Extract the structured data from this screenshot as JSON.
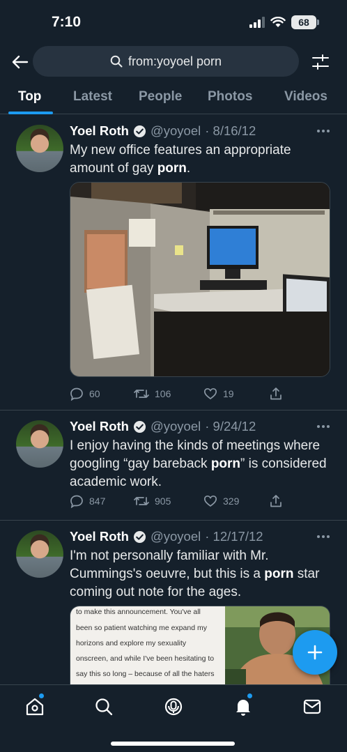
{
  "status_bar": {
    "time": "7:10",
    "battery": "68"
  },
  "search": {
    "query": "from:yoyoel porn"
  },
  "tabs": [
    {
      "label": "Top",
      "active": true
    },
    {
      "label": "Latest",
      "active": false
    },
    {
      "label": "People",
      "active": false
    },
    {
      "label": "Photos",
      "active": false
    },
    {
      "label": "Videos",
      "active": false
    }
  ],
  "tweets": [
    {
      "name": "Yoel Roth",
      "handle": "@yoyoel",
      "date": "· 8/16/12",
      "text_before": "My new office features an appropriate amount of gay ",
      "text_bold": "porn",
      "text_after": ".",
      "replies": "60",
      "retweets": "106",
      "likes": "19"
    },
    {
      "name": "Yoel Roth",
      "handle": "@yoyoel",
      "date": "· 9/24/12",
      "text_before": "I enjoy having the kinds of meetings where googling “gay bareback ",
      "text_bold": "porn",
      "text_after": "” is considered academic work.",
      "replies": "847",
      "retweets": "905",
      "likes": "329"
    },
    {
      "name": "Yoel Roth",
      "handle": "@yoyoel",
      "date": "· 12/17/12",
      "text_before": "I'm not personally familiar with Mr. Cummings's oeuvre, but this is a ",
      "text_bold": "porn",
      "text_after": " star coming out note for the ages.",
      "media_text": [
        "to make this announcement. You've all",
        "been so patient watching me expand my",
        "horizons and explore my sexuality",
        "onscreen, and while I've been hesitating to",
        "say this so long – because of all the haters"
      ]
    }
  ],
  "colors": {
    "background": "#15202b",
    "accent": "#1d9bf0",
    "muted": "#8b98a5",
    "divider": "#38444d"
  },
  "icons": [
    "back-arrow-icon",
    "search-icon",
    "filter-icon",
    "verified-icon",
    "more-icon",
    "reply-icon",
    "retweet-icon",
    "like-icon",
    "share-icon",
    "compose-icon",
    "home-icon",
    "explore-icon",
    "spaces-icon",
    "notifications-icon",
    "messages-icon"
  ]
}
